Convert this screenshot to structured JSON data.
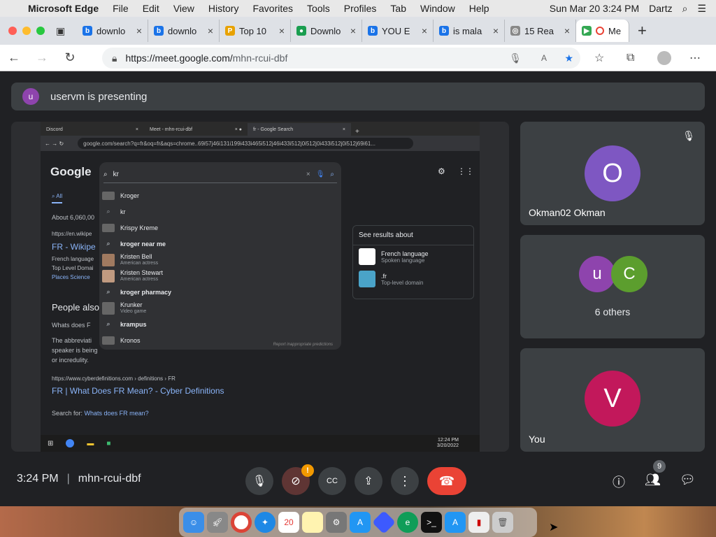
{
  "mac_menubar": {
    "app": "Microsoft Edge",
    "menus": [
      "File",
      "Edit",
      "View",
      "History",
      "Favorites",
      "Tools",
      "Profiles",
      "Tab",
      "Window",
      "Help"
    ],
    "datetime": "Sun Mar 20  3:24 PM",
    "user": "Dartz"
  },
  "browser": {
    "tabs": [
      {
        "title": "downlo",
        "color": "#1a73e8"
      },
      {
        "title": "downlo",
        "color": "#1a73e8"
      },
      {
        "title": "Top 10",
        "color": "#e8a200"
      },
      {
        "title": "Downlo",
        "color": "#1a9e50"
      },
      {
        "title": "YOU E",
        "color": "#1a73e8"
      },
      {
        "title": "is mala",
        "color": "#1a73e8"
      },
      {
        "title": "15 Rea",
        "color": "#888888"
      },
      {
        "title": "Me",
        "color": "#ea4335"
      }
    ],
    "url_host": "https://meet.google.com/",
    "url_path": "mhn-rcui-dbf"
  },
  "presenting": {
    "avatar_letter": "u",
    "text": "uservm is presenting"
  },
  "shared_screen": {
    "tabs": [
      "Discord",
      "Meet - mhn-rcui-dbf",
      "fr - Google Search"
    ],
    "url": "google.com/search?q=fr&oq=fr&aqs=chrome..69i57j46i131i199i433i465i512j46i433i512j0i512j0i433i512j0i512j69i61...",
    "logo": "Google",
    "query": "kr",
    "suggestions": [
      {
        "text": "Kroger",
        "sub": "",
        "bold": false
      },
      {
        "text": "kr",
        "sub": "",
        "bold": false
      },
      {
        "text": "Krispy Kreme",
        "sub": "",
        "bold": false
      },
      {
        "text": "kroger near me",
        "sub": "",
        "bold": true
      },
      {
        "text": "Kristen Bell",
        "sub": "American actress",
        "bold": false
      },
      {
        "text": "Kristen Stewart",
        "sub": "American actress",
        "bold": false
      },
      {
        "text": "kroger pharmacy",
        "sub": "",
        "bold": true
      },
      {
        "text": "Krunker",
        "sub": "Video game",
        "bold": false
      },
      {
        "text": "krampus",
        "sub": "",
        "bold": true
      },
      {
        "text": "Kronos",
        "sub": "",
        "bold": false
      }
    ],
    "report_text": "Report inappropriate predictions",
    "tab_all": "All",
    "about_results": "About 6,060,00",
    "wiki_url": "https://en.wikipe",
    "wiki_title": "FR - Wikipe",
    "wiki_lines": [
      "French language",
      "Top Level Domai"
    ],
    "wiki_links": "Places   Science",
    "people_also": "People also",
    "whats_does": "Whats does F",
    "abbrev_line1": "The abbreviati",
    "abbrev_line2": "speaker is being",
    "abbrev_line3": "or incredulity.",
    "cyber_url": "https://www.cyberdefinitions.com › definitions › FR",
    "cyber_title": "FR | What Does FR Mean? - Cyber Definitions",
    "search_for_label": "Search for:",
    "search_for_link": "Whats does FR mean?",
    "panel_header": "See results about",
    "panel_items": [
      {
        "title": "French language",
        "sub": "Spoken language"
      },
      {
        "title": ".fr",
        "sub": "Top-level domain"
      }
    ],
    "taskbar_time": "12:24 PM",
    "taskbar_date": "3/20/2022"
  },
  "participants": [
    {
      "letter": "O",
      "name": "Okman02 Okman",
      "color": "#7e57c2"
    },
    {
      "letters": [
        "u",
        "C"
      ],
      "colors": [
        "#8e44ad",
        "#5c9e2e"
      ],
      "label": "6 others"
    },
    {
      "letter": "V",
      "name": "You",
      "color": "#c2185b"
    }
  ],
  "controls": {
    "time": "3:24 PM",
    "meeting_code": "mhn-rcui-dbf",
    "people_badge": "9"
  }
}
